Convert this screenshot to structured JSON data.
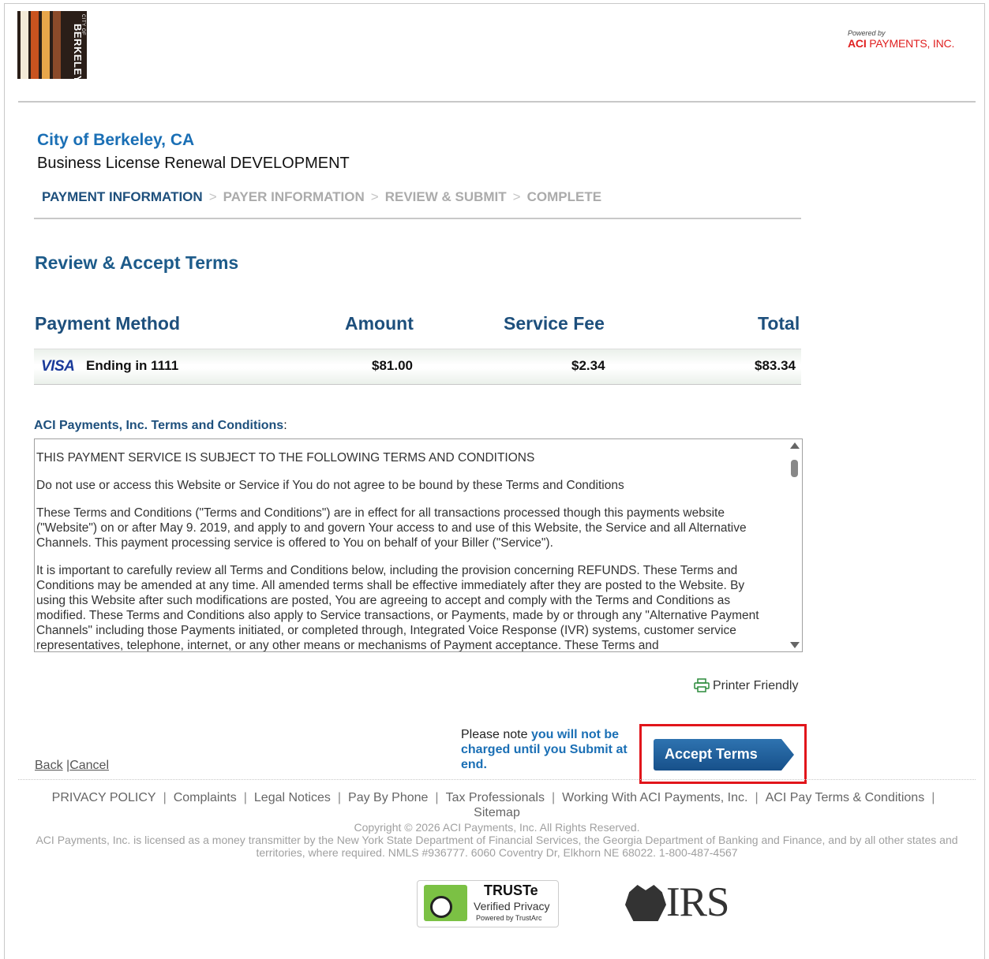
{
  "header": {
    "city_logo_small": "CITY OF",
    "city_logo_big": "BERKELEY",
    "powered_by": "Powered by",
    "aci_brand": "ACI",
    "aci_name": "PAYMENTS, INC."
  },
  "page": {
    "city": "City of Berkeley, CA",
    "license": "Business License Renewal DEVELOPMENT",
    "section_title": "Review & Accept Terms"
  },
  "steps": [
    {
      "label": "PAYMENT INFORMATION",
      "active": true
    },
    {
      "label": "PAYER INFORMATION",
      "active": false
    },
    {
      "label": "REVIEW & SUBMIT",
      "active": false
    },
    {
      "label": "COMPLETE",
      "active": false
    }
  ],
  "payment_table": {
    "headers": {
      "method": "Payment Method",
      "amount": "Amount",
      "fee": "Service Fee",
      "total": "Total"
    },
    "row": {
      "card_brand": "VISA",
      "card_ending": "Ending in 1111",
      "amount": "$81.00",
      "fee": "$2.34",
      "total": "$83.34"
    }
  },
  "terms": {
    "label": "ACI Payments, Inc. Terms and Conditions",
    "colon": ":",
    "paragraphs": [
      "THIS PAYMENT SERVICE IS SUBJECT TO THE FOLLOWING TERMS AND CONDITIONS",
      "Do not use or access this Website or Service if You do not agree to be bound by these Terms and Conditions",
      "These Terms and Conditions (\"Terms and Conditions\") are in effect for all transactions processed though this payments website (\"Website\") on or after May 9. 2019, and apply to and govern Your access to and use of this Website, the Service and all Alternative Channels. This payment processing service is offered to You on behalf of your Biller (\"Service\").",
      "It is important to carefully review all Terms and Conditions below, including the provision concerning REFUNDS. These Terms and Conditions may be amended at any time. All amended terms shall be effective immediately after they are posted to the Website. By using this Website after such modifications are posted, You are agreeing to accept and comply with the Terms and Conditions as modified. These Terms and Conditions also apply to Service transactions, or Payments, made by or through any \"Alternative Payment Channels\" including those Payments initiated, or completed through, Integrated Voice Response (IVR) systems, customer service representatives, telephone, internet, or any other means or mechanisms of Payment acceptance. These Terms and"
    ]
  },
  "actions": {
    "printer_friendly": "Printer Friendly",
    "back": "Back",
    "divider": "|",
    "cancel": "Cancel",
    "note_prefix": "Please note ",
    "note_highlight": "you will not be charged until you Submit at end.",
    "accept": "Accept Terms"
  },
  "footer": {
    "links": [
      "PRIVACY POLICY",
      "Complaints",
      "Legal Notices",
      "Pay By Phone",
      "Tax Professionals",
      "Working With ACI Payments, Inc.",
      "ACI Pay Terms & Conditions",
      "Sitemap"
    ],
    "copyright": "Copyright © 2026 ACI Payments, Inc. All Rights Reserved.",
    "license_text": "ACI Payments, Inc. is licensed as a money transmitter by the New York State Department of Financial Services, the Georgia Department of Banking and Finance, and by all other states and territories, where required. NMLS #936777. 6060 Coventry Dr, Elkhorn NE 68022. 1-800-487-4567",
    "truste_title": "TRUSTe",
    "truste_sub": "Verified Privacy",
    "truste_powered": "Powered by TrustArc",
    "irs": "IRS"
  },
  "colors": {
    "accent": "#1a6fb5",
    "highlight_frame": "#e1151b",
    "button": "#1d5c98"
  }
}
